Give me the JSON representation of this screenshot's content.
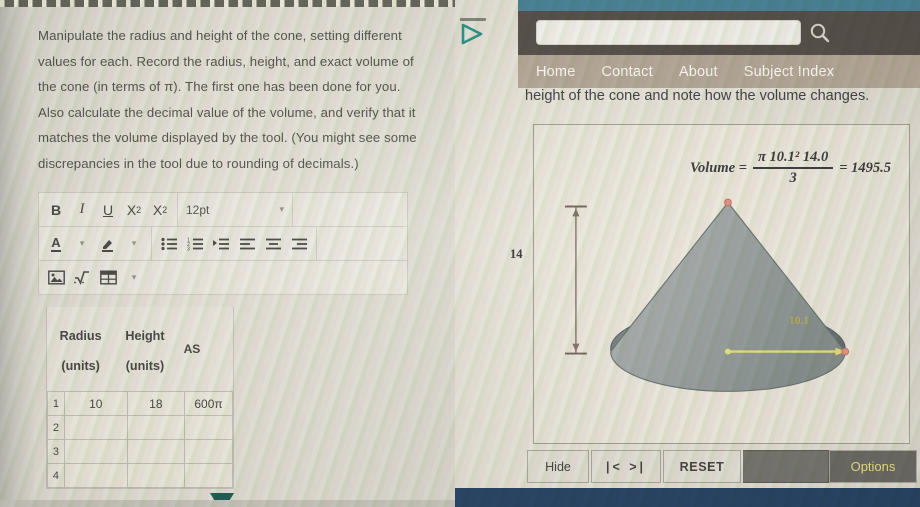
{
  "document": {
    "instructions": "Manipulate the radius and height of the cone, setting different values for each. Record the radius, height, and exact volume of the cone (in terms of π). The first one has been done for you. Also calculate the decimal value of the volume, and verify that it matches the volume displayed by the tool. (You might see some discrepancies in the tool due to rounding of decimals.)"
  },
  "editor_toolbar": {
    "bold": "B",
    "italic": "I",
    "underline": "U",
    "superscript_base": "X",
    "superscript_exp": "2",
    "subscript_base": "X",
    "subscript_idx": "2",
    "font_size": "12pt",
    "text_color": "A",
    "icons": {
      "chevron": "⌄",
      "highlighter": "highlighter-icon",
      "bullet_list": "bullet-list-icon",
      "numbered_list": "numbered-list-icon",
      "indent": "indent-icon",
      "align_left": "align-left-icon",
      "align_center": "align-center-icon",
      "align_right": "align-right-icon",
      "image": "image-icon",
      "equation": "equation-icon",
      "table": "table-icon"
    }
  },
  "answer_table": {
    "headers": [
      {
        "line1": "Radius",
        "line2": "(units)"
      },
      {
        "line1": "Height",
        "line2": "(units)"
      },
      {
        "line1": "AS",
        "line2": ""
      }
    ],
    "rows": [
      {
        "index": "1",
        "radius": "10",
        "height": "18",
        "volume": "600π"
      },
      {
        "index": "2",
        "radius": "",
        "height": "",
        "volume": ""
      },
      {
        "index": "3",
        "radius": "",
        "height": "",
        "volume": ""
      },
      {
        "index": "4",
        "radius": "",
        "height": "",
        "volume": ""
      }
    ]
  },
  "applet": {
    "search": {
      "value": "",
      "icon": "search-icon"
    },
    "nav": [
      {
        "label": "Home"
      },
      {
        "label": "Contact"
      },
      {
        "label": "About"
      },
      {
        "label": "Subject Index"
      }
    ],
    "page_text": "height of the cone and note how the volume changes.",
    "formula": {
      "lead": "Volume =",
      "numerator": "π 10.1² 14.0",
      "denominator": "3",
      "equals": "= 1495.5"
    },
    "labels": {
      "height": "14",
      "radius": "10.1"
    },
    "controls": {
      "hide": "Hide",
      "step": "|<  >|",
      "reset": "RESET",
      "options": "Options"
    }
  },
  "colors": {
    "nav_band": "#b0a493",
    "search_band": "#4b4540",
    "chrome": "#3e7d93",
    "cone_light": "#a9aeab",
    "cone_dark": "#5d6b6b",
    "radius_arrow": "#e9e06a",
    "options_text": "#e9e07a",
    "teal_cursor": "#1b8f82"
  },
  "chart_data": {
    "type": "diagram",
    "shape": "cone",
    "radius": 10.1,
    "height": 14.0,
    "volume_exact": "π · 10.1² · 14.0 / 3",
    "volume_decimal": 1495.5,
    "annotations": [
      {
        "label": "14",
        "kind": "height-dimension"
      },
      {
        "label": "10.1",
        "kind": "radius-dimension"
      }
    ]
  }
}
